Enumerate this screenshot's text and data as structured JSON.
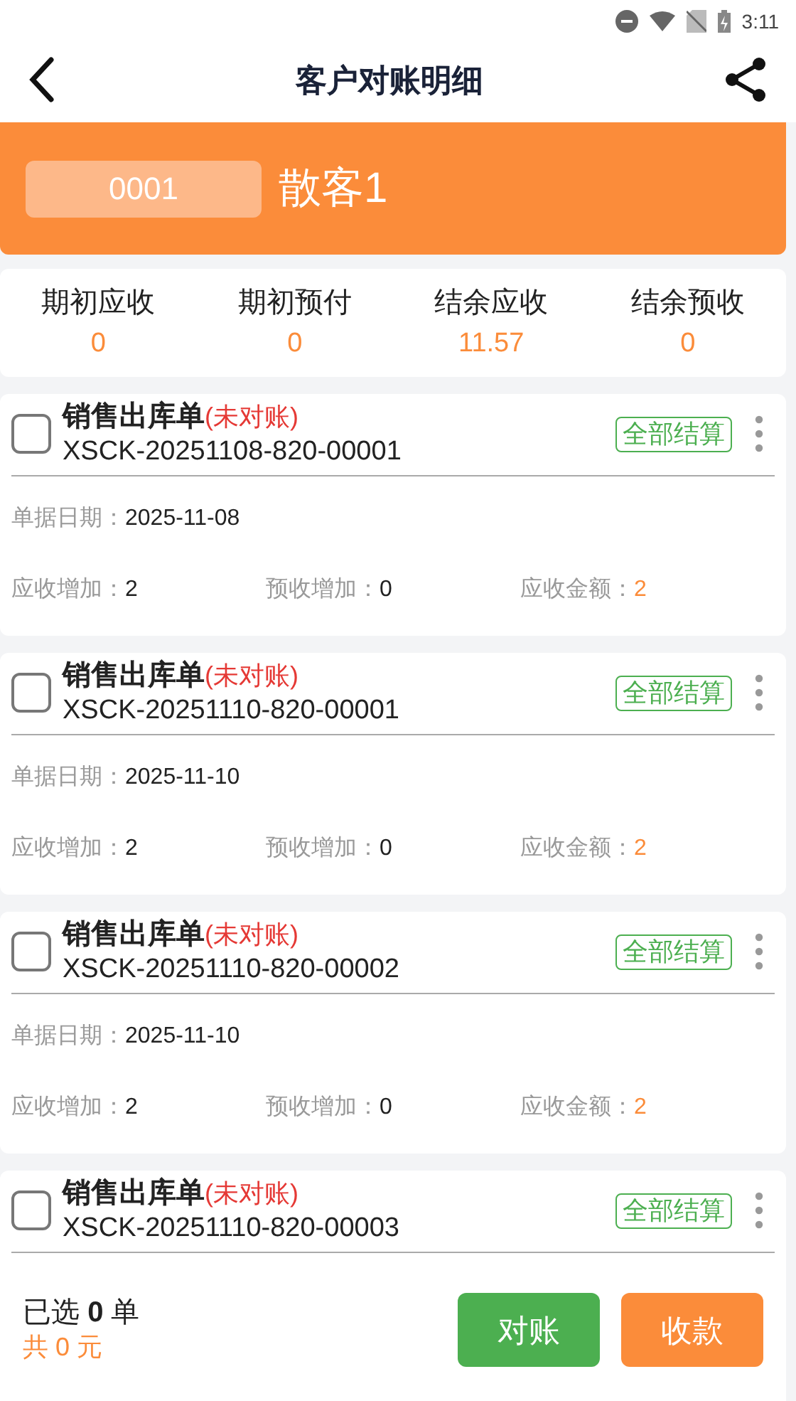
{
  "status_bar": {
    "time": "3:11"
  },
  "header": {
    "title": "客户对账明细"
  },
  "customer": {
    "code": "0001",
    "name": "散客1"
  },
  "summary": [
    {
      "label": "期初应收",
      "value": "0"
    },
    {
      "label": "期初预付",
      "value": "0"
    },
    {
      "label": "结余应收",
      "value": "11.57"
    },
    {
      "label": "结余预收",
      "value": "0"
    }
  ],
  "orders": [
    {
      "title": "销售出库单",
      "status": "(未对账)",
      "number": "XSCK-20251108-820-00001",
      "checked": false,
      "badge": "全部结算",
      "date_label": "单据日期：",
      "date": "2025-11-08",
      "fields": [
        {
          "label": "应收增加：",
          "value": "2",
          "kind": "plain"
        },
        {
          "label": "预收增加：",
          "value": "0",
          "kind": "plain"
        },
        {
          "label": "应收金额：",
          "value": "2",
          "kind": "amount"
        }
      ]
    },
    {
      "title": "销售出库单",
      "status": "(未对账)",
      "number": "XSCK-20251110-820-00001",
      "checked": false,
      "badge": "全部结算",
      "date_label": "单据日期：",
      "date": "2025-11-10",
      "fields": [
        {
          "label": "应收增加：",
          "value": "2",
          "kind": "plain"
        },
        {
          "label": "预收增加：",
          "value": "0",
          "kind": "plain"
        },
        {
          "label": "应收金额：",
          "value": "2",
          "kind": "amount"
        }
      ]
    },
    {
      "title": "销售出库单",
      "status": "(未对账)",
      "number": "XSCK-20251110-820-00002",
      "checked": false,
      "badge": "全部结算",
      "date_label": "单据日期：",
      "date": "2025-11-10",
      "fields": [
        {
          "label": "应收增加：",
          "value": "2",
          "kind": "plain"
        },
        {
          "label": "预收增加：",
          "value": "0",
          "kind": "plain"
        },
        {
          "label": "应收金额：",
          "value": "2",
          "kind": "amount"
        }
      ]
    },
    {
      "title": "销售出库单",
      "status": "(未对账)",
      "number": "XSCK-20251110-820-00003",
      "checked": false,
      "badge": "全部结算"
    }
  ],
  "footer": {
    "selected": "已选 **0** 单",
    "total": "共 0 元",
    "buttons": [
      {
        "label": "对账",
        "kind": "reconcile"
      },
      {
        "label": "收款",
        "kind": "collect"
      }
    ]
  }
}
